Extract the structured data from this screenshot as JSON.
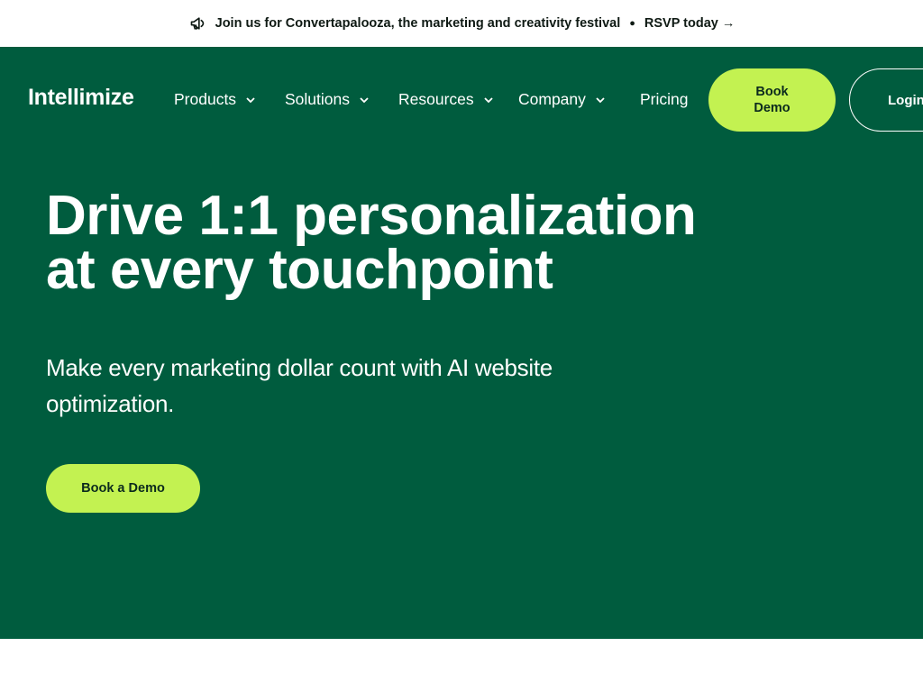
{
  "announcement": {
    "icon": "megaphone-icon",
    "text": "Join us for Convertapalooza, the marketing and creativity festival",
    "separator": "●",
    "link": "RSVP today →"
  },
  "nav": {
    "logo": "Intellimize",
    "items": [
      {
        "label": "Products",
        "has_dropdown": true
      },
      {
        "label": "Solutions",
        "has_dropdown": true
      },
      {
        "label": "Resources",
        "has_dropdown": true
      },
      {
        "label": "Company",
        "has_dropdown": true
      },
      {
        "label": "Pricing",
        "has_dropdown": false
      }
    ],
    "book_demo": "Book Demo",
    "login": "Login"
  },
  "hero": {
    "headline_line1": "Drive 1:1 personalization",
    "headline_line2": "at every touchpoint",
    "subhead": "Make every marketing dollar count with AI website optimization.",
    "cta": "Book a Demo"
  },
  "colors": {
    "hero_bg": "#005c3e",
    "accent": "#c3f251",
    "text_light": "#ffffff",
    "text_dark": "#0f1a14"
  }
}
